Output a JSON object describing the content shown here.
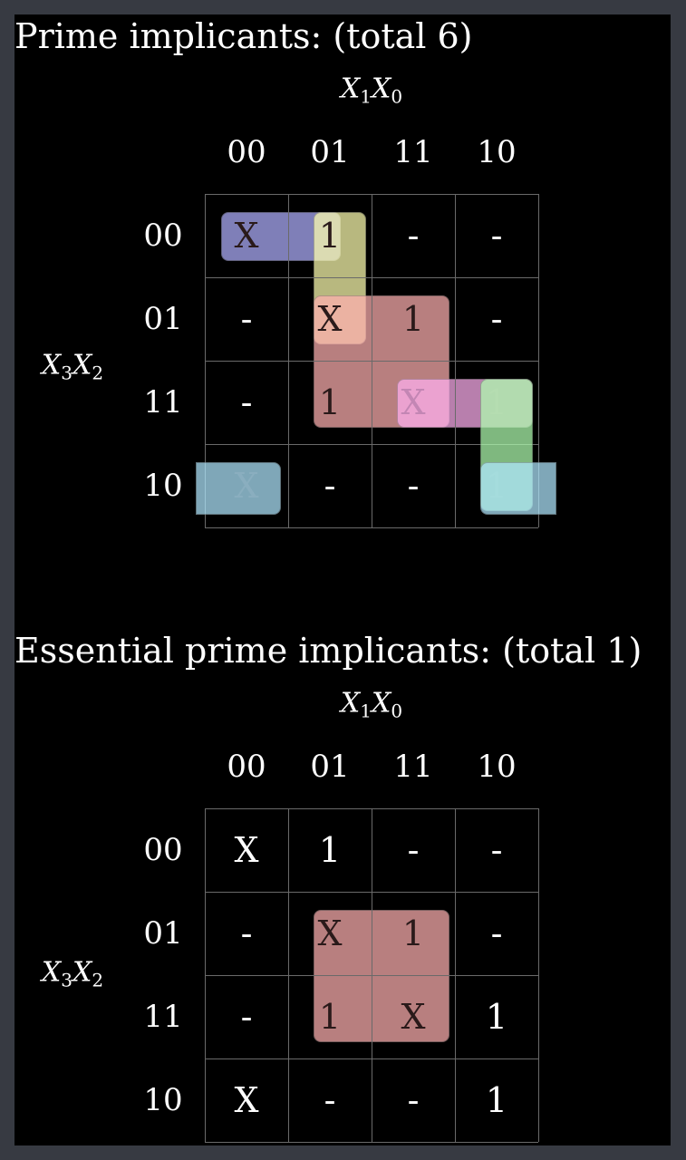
{
  "maps": [
    {
      "heading": "Prime implicants: (total 6)",
      "col_var": {
        "a": "X",
        "a_sub": "1",
        "b": "X",
        "b_sub": "0"
      },
      "row_var": {
        "a": "X",
        "a_sub": "3",
        "b": "X",
        "b_sub": "2"
      },
      "col_labels": [
        "00",
        "01",
        "11",
        "10"
      ],
      "row_labels": [
        "00",
        "01",
        "11",
        "10"
      ],
      "cells": [
        [
          "X",
          "1",
          "-",
          "-"
        ],
        [
          "-",
          "X",
          "1",
          "-"
        ],
        [
          "-",
          "1",
          "X",
          "1"
        ],
        [
          "X",
          "-",
          "-",
          "1"
        ]
      ],
      "groups": [
        {
          "color": "#b0b0ff"
        },
        {
          "color": "#ffffb0"
        },
        {
          "color": "#ffb0b0"
        },
        {
          "color": "#ffb0f0"
        },
        {
          "color": "#b0ffb0"
        },
        {
          "color": "#b0e8ff"
        }
      ]
    },
    {
      "heading": "Essential prime implicants: (total 1)",
      "col_var": {
        "a": "X",
        "a_sub": "1",
        "b": "X",
        "b_sub": "0"
      },
      "row_var": {
        "a": "X",
        "a_sub": "3",
        "b": "X",
        "b_sub": "2"
      },
      "col_labels": [
        "00",
        "01",
        "11",
        "10"
      ],
      "row_labels": [
        "00",
        "01",
        "11",
        "10"
      ],
      "cells": [
        [
          "X",
          "1",
          "-",
          "-"
        ],
        [
          "-",
          "X",
          "1",
          "-"
        ],
        [
          "-",
          "1",
          "X",
          "1"
        ],
        [
          "X",
          "-",
          "-",
          "1"
        ]
      ],
      "groups": [
        {
          "color": "#ffb0b0"
        }
      ]
    }
  ]
}
